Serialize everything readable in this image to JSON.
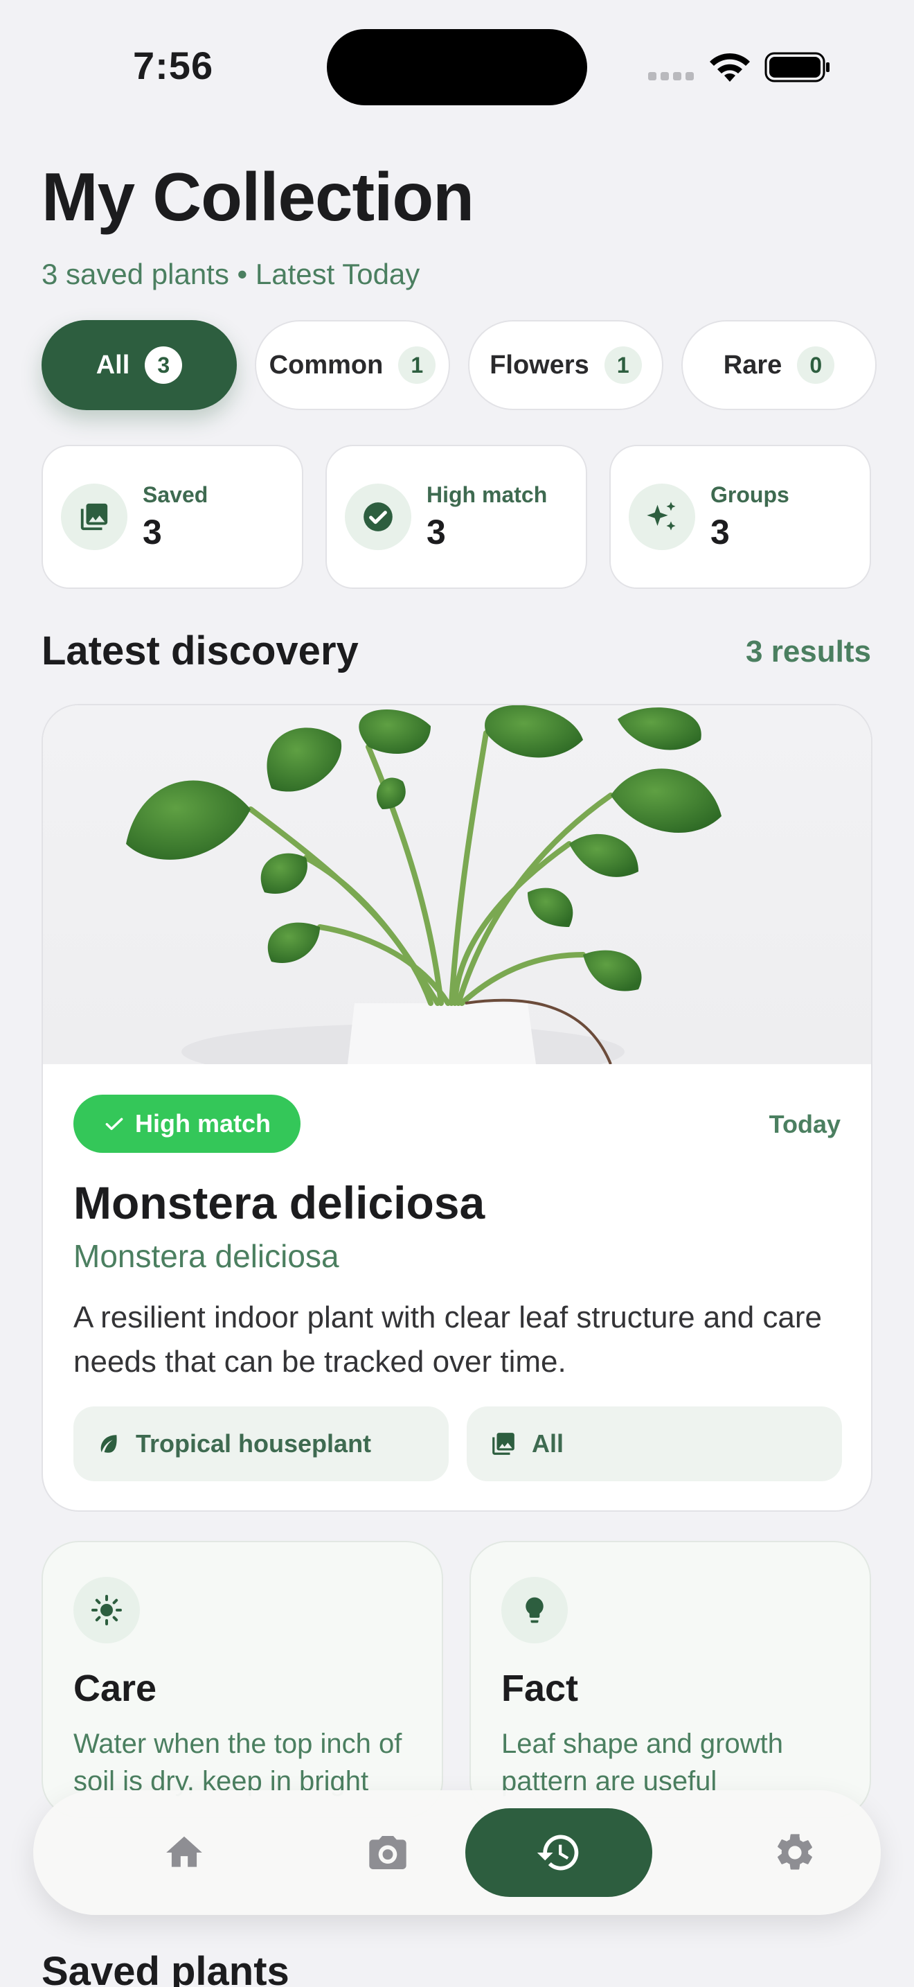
{
  "status_bar": {
    "time": "7:56"
  },
  "header": {
    "title": "My Collection",
    "subtitle": "3 saved plants • Latest Today"
  },
  "filters": [
    {
      "label": "All",
      "count": "3",
      "active": true
    },
    {
      "label": "Common",
      "count": "1",
      "active": false
    },
    {
      "label": "Flowers",
      "count": "1",
      "active": false
    },
    {
      "label": "Rare",
      "count": "0",
      "active": false
    }
  ],
  "stats": [
    {
      "label": "Saved",
      "value": "3",
      "icon": "photo-library-icon"
    },
    {
      "label": "High match",
      "value": "3",
      "icon": "check-circle-icon"
    },
    {
      "label": "Groups",
      "value": "3",
      "icon": "sparkle-icon"
    }
  ],
  "latest": {
    "section_title": "Latest discovery",
    "results": "3 results",
    "badge": "High match",
    "date": "Today",
    "name": "Monstera deliciosa",
    "scientific_name": "Monstera deliciosa",
    "description": "A resilient indoor plant with clear leaf structure and care needs that can be tracked over time.",
    "tags": [
      {
        "label": "Tropical houseplant",
        "icon": "leaf-icon"
      },
      {
        "label": "All",
        "icon": "photo-library-icon"
      }
    ]
  },
  "info_cards": [
    {
      "title": "Care",
      "text": "Water when the top inch of soil is dry, keep in bright",
      "icon": "sun-icon"
    },
    {
      "title": "Fact",
      "text": "Leaf shape and growth pattern are useful",
      "icon": "lightbulb-icon"
    }
  ],
  "saved_section_title": "Saved plants",
  "tabbar": [
    {
      "name": "home",
      "icon": "home-icon",
      "active": false
    },
    {
      "name": "camera",
      "icon": "camera-icon",
      "active": false
    },
    {
      "name": "history",
      "icon": "history-icon",
      "active": true
    },
    {
      "name": "settings",
      "icon": "gear-icon",
      "active": false
    }
  ],
  "colors": {
    "accent": "#2d5e3f",
    "accent_text": "#4b7f60",
    "success": "#34c759",
    "background": "#f2f2f5"
  }
}
